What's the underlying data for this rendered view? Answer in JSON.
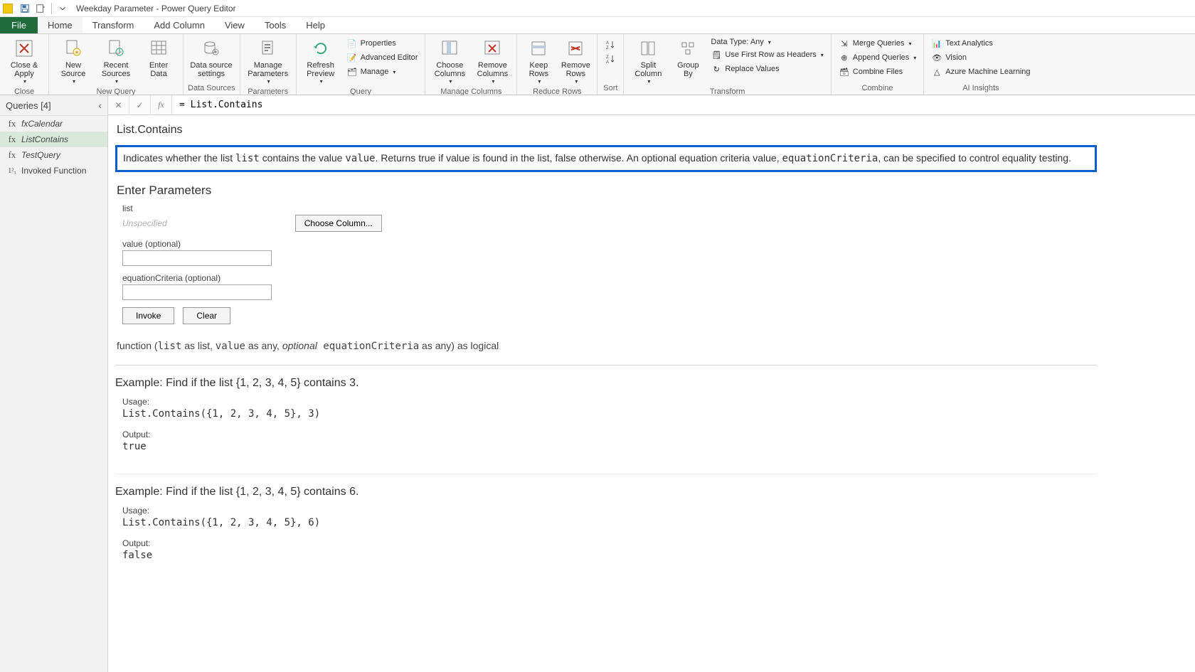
{
  "titlebar": {
    "title": "Weekday Parameter - Power Query Editor"
  },
  "menu": {
    "file": "File",
    "tabs": [
      "Home",
      "Transform",
      "Add Column",
      "View",
      "Tools",
      "Help"
    ],
    "active": "Home"
  },
  "ribbon": {
    "close": {
      "big": "Close &\nApply",
      "group": "Close"
    },
    "newquery": {
      "new_source": "New\nSource",
      "recent_sources": "Recent\nSources",
      "enter_data": "Enter\nData",
      "group": "New Query"
    },
    "datasources": {
      "settings": "Data source\nsettings",
      "group": "Data Sources"
    },
    "parameters": {
      "manage": "Manage\nParameters",
      "group": "Parameters"
    },
    "query": {
      "refresh": "Refresh\nPreview",
      "properties": "Properties",
      "advanced": "Advanced Editor",
      "manage": "Manage",
      "group": "Query"
    },
    "managecols": {
      "choose": "Choose\nColumns",
      "remove": "Remove\nColumns",
      "group": "Manage Columns"
    },
    "reducerows": {
      "keep": "Keep\nRows",
      "remove": "Remove\nRows",
      "group": "Reduce Rows"
    },
    "sort": {
      "group": "Sort"
    },
    "transform": {
      "split": "Split\nColumn",
      "groupby": "Group\nBy",
      "datatype": "Data Type: Any",
      "firstrow": "Use First Row as Headers",
      "replace": "Replace Values",
      "group": "Transform"
    },
    "combine": {
      "merge": "Merge Queries",
      "append": "Append Queries",
      "files": "Combine Files",
      "group": "Combine"
    },
    "ai": {
      "text": "Text Analytics",
      "vision": "Vision",
      "ml": "Azure Machine Learning",
      "group": "AI Insights"
    }
  },
  "queries": {
    "header": "Queries [4]",
    "items": [
      {
        "icon": "fx",
        "label": "fxCalendar"
      },
      {
        "icon": "fx",
        "label": "ListContains"
      },
      {
        "icon": "fx",
        "label": "TestQuery"
      },
      {
        "icon": "123",
        "label": "Invoked Function"
      }
    ],
    "selected": 1
  },
  "formula": "= List.Contains",
  "function": {
    "name": "List.Contains",
    "description_pre": "Indicates whether the list ",
    "description_code1": "list",
    "description_mid1": " contains the value ",
    "description_code2": "value",
    "description_mid2": ". Returns true if value is found in the list, false otherwise. An optional equation criteria value, ",
    "description_code3": "equationCriteria",
    "description_post": ", can be specified to control equality testing.",
    "enter_params": "Enter Parameters",
    "params": {
      "list": {
        "label": "list",
        "placeholder": "Unspecified",
        "choose": "Choose Column..."
      },
      "value": {
        "label": "value (optional)"
      },
      "eq": {
        "label": "equationCriteria (optional)"
      }
    },
    "invoke": "Invoke",
    "clear": "Clear",
    "sig_pre": "function (",
    "sig_c1": "list",
    "sig_m1": " as list, ",
    "sig_c2": "value",
    "sig_m2": " as any, ",
    "sig_opt": "optional",
    "sig_c3": " equationCriteria",
    "sig_post": " as any) as logical",
    "examples": [
      {
        "head": "Example: Find if the list {1, 2, 3, 4, 5} contains 3.",
        "usage_lbl": "Usage:",
        "usage": "List.Contains({1, 2, 3, 4, 5}, 3)",
        "output_lbl": "Output:",
        "output": "true"
      },
      {
        "head": "Example: Find if the list {1, 2, 3, 4, 5} contains 6.",
        "usage_lbl": "Usage:",
        "usage": "List.Contains({1, 2, 3, 4, 5}, 6)",
        "output_lbl": "Output:",
        "output": "false"
      }
    ]
  }
}
